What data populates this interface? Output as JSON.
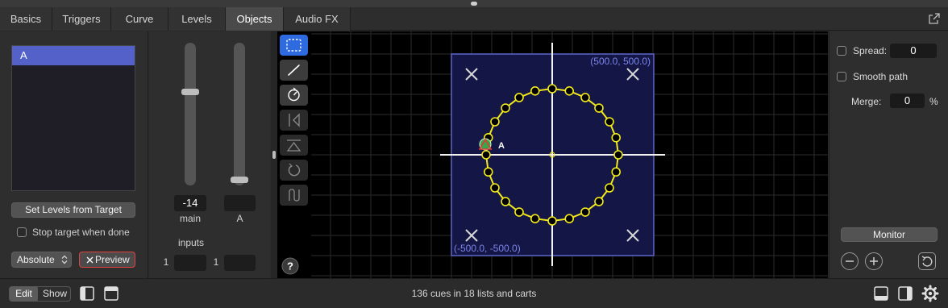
{
  "tabs": [
    {
      "label": "Basics",
      "active": false
    },
    {
      "label": "Triggers",
      "active": false
    },
    {
      "label": "Curve",
      "active": false
    },
    {
      "label": "Levels",
      "active": false
    },
    {
      "label": "Objects",
      "active": true
    },
    {
      "label": "Audio FX",
      "active": false
    }
  ],
  "left_panel": {
    "targets": [
      "A"
    ],
    "set_levels_label": "Set Levels from Target",
    "stop_target_label": "Stop target when done",
    "stop_target_checked": false,
    "mode_select": "Absolute",
    "preview_label": "Preview",
    "preview_icon": "x-icon"
  },
  "faders": {
    "main": {
      "value": "-14",
      "label": "main",
      "level": 0.66
    },
    "object": {
      "value": "",
      "label": "A",
      "level": 0.02
    },
    "inputs_label": "inputs",
    "inputs": [
      {
        "number": "1",
        "value": ""
      },
      {
        "number": "1",
        "value": ""
      }
    ]
  },
  "tools": [
    {
      "icon": "selection-rect-icon",
      "state": "selected"
    },
    {
      "icon": "line-tool-icon",
      "state": "normal"
    },
    {
      "icon": "rotate-dial-icon",
      "state": "normal"
    },
    {
      "icon": "flip-horizontal-icon",
      "state": "disabled"
    },
    {
      "icon": "flip-vertical-icon",
      "state": "disabled"
    },
    {
      "icon": "rotate-icon",
      "state": "disabled"
    },
    {
      "icon": "reverse-path-icon",
      "state": "disabled"
    }
  ],
  "help_icon": "question-icon",
  "canvas": {
    "top_right_label": "(500.0, 500.0)",
    "bottom_left_label": "(-500.0, -500.0)",
    "object_label": "A",
    "path_points": 24,
    "colors": {
      "region": "#141646",
      "region_border": "#5f67c8",
      "path": "#f2ea1c",
      "object": "#3aa64a"
    }
  },
  "right_panel": {
    "spread_label": "Spread:",
    "spread_value": "0",
    "spread_checked": false,
    "smooth_label": "Smooth path",
    "smooth_checked": false,
    "merge_label": "Merge:",
    "merge_value": "0",
    "merge_unit": "%",
    "monitor_label": "Monitor",
    "buttons": [
      "zoom-out-icon",
      "zoom-in-icon",
      "undo-icon"
    ]
  },
  "status": {
    "edit_label": "Edit",
    "show_label": "Show",
    "mode": "Edit",
    "center_text": "136 cues in 18 lists and carts",
    "left_icons": [
      "sidebar-left-icon",
      "panel-top-icon"
    ],
    "right_icons": [
      "panel-bottom-icon",
      "sidebar-right-icon",
      "gear-icon"
    ]
  }
}
